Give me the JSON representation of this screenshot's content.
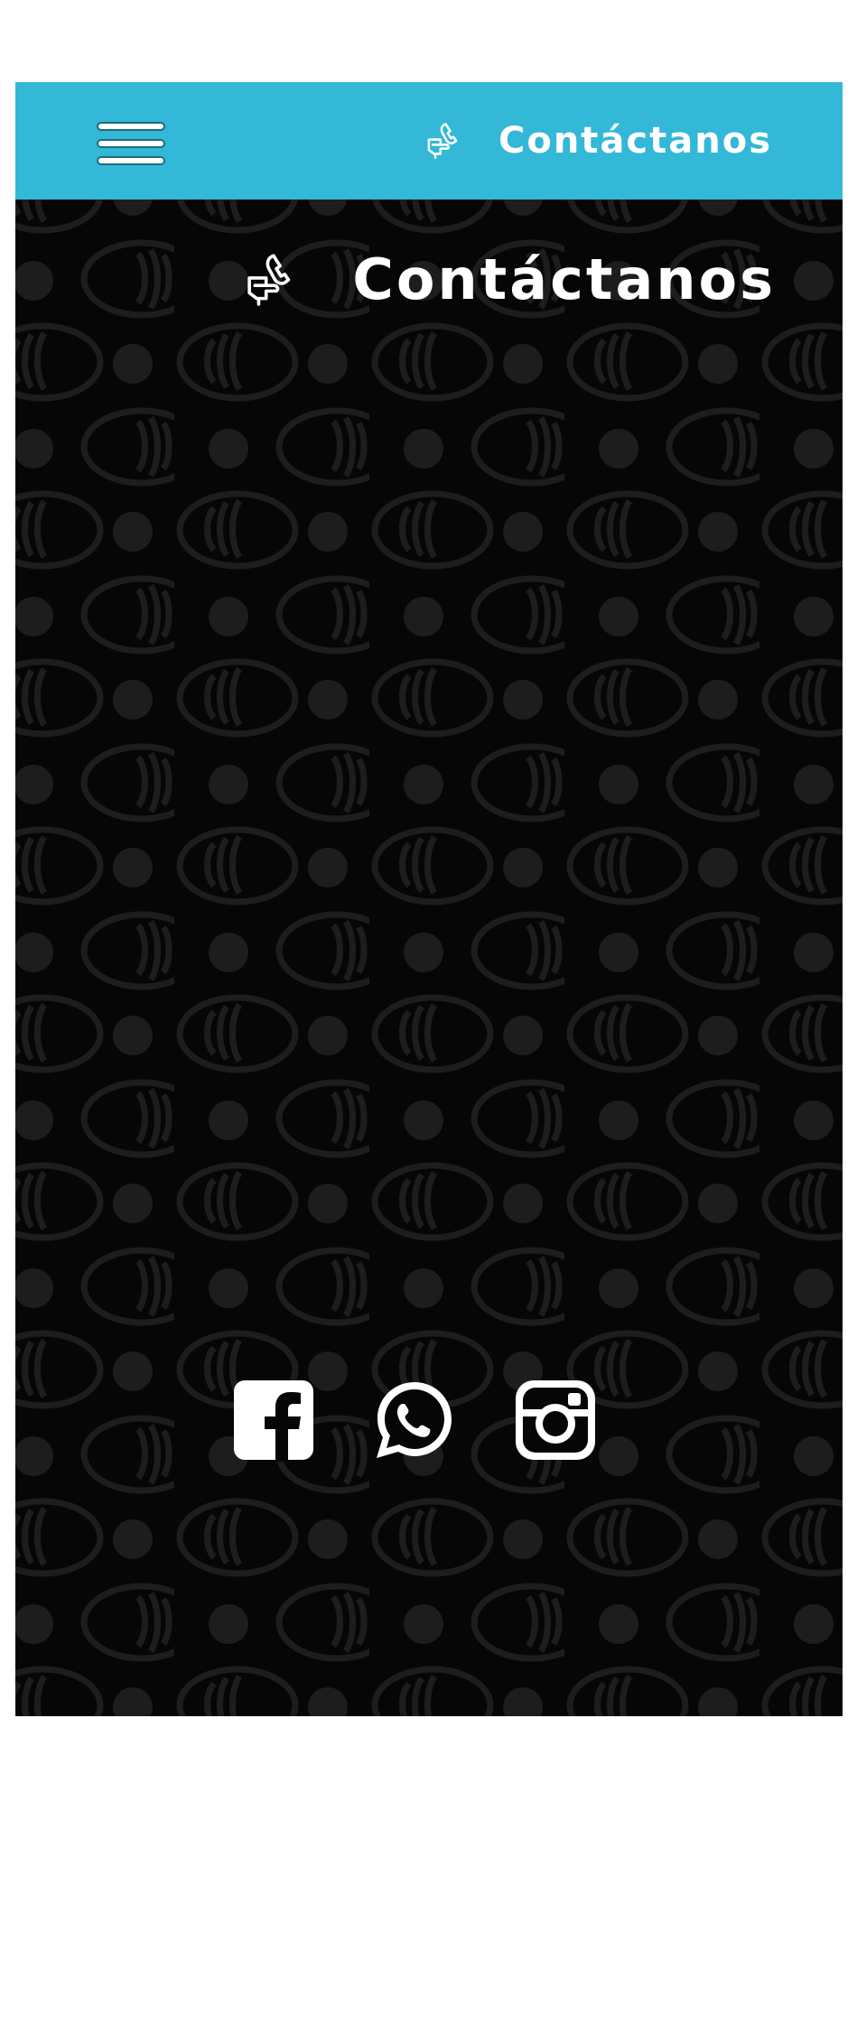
{
  "header": {
    "menu_icon": "hamburger-menu-icon",
    "contact_icon": "phone-hand-icon",
    "contact_label": "Contáctanos",
    "background_color": "#33b8d7"
  },
  "hero": {
    "background_color": "#060606",
    "pattern": "sushi-pattern",
    "title_icon": "phone-hand-icon",
    "title": "Contáctanos"
  },
  "social": {
    "items": [
      {
        "name": "facebook",
        "icon": "facebook-icon"
      },
      {
        "name": "whatsapp",
        "icon": "whatsapp-icon"
      },
      {
        "name": "instagram",
        "icon": "instagram-icon"
      }
    ]
  }
}
